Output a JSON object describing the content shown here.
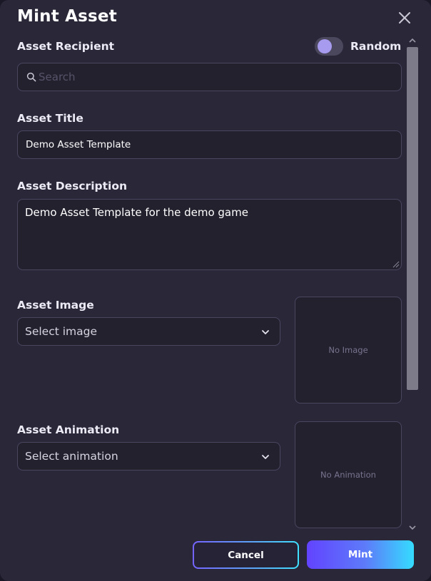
{
  "modal": {
    "title": "Mint Asset",
    "close_icon": "close-icon"
  },
  "recipient": {
    "label": "Asset Recipient",
    "search_placeholder": "Search",
    "search_icon": "search-icon",
    "random_toggle": {
      "label": "Random",
      "on": false
    }
  },
  "title_field": {
    "label": "Asset Title",
    "value": "Demo Asset Template"
  },
  "description_field": {
    "label": "Asset Description",
    "value": "Demo Asset Template for the demo game"
  },
  "image_field": {
    "label": "Asset Image",
    "selected": "Select image",
    "preview_text": "No Image"
  },
  "animation_field": {
    "label": "Asset Animation",
    "selected": "Select animation",
    "preview_text": "No Animation"
  },
  "buttons": {
    "cancel_label": "Cancel",
    "mint_label": "Mint"
  },
  "colors": {
    "background": "#2a2739",
    "field": "#24212f",
    "accent": "#6243ff",
    "accent_end": "#35dcff",
    "toggle_knob": "#a79bf0"
  }
}
